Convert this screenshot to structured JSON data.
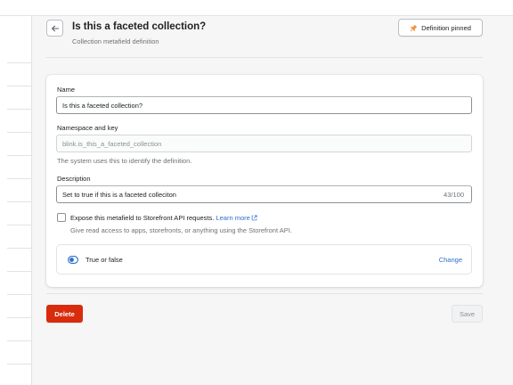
{
  "header": {
    "title": "Is this a faceted collection?",
    "subtitle": "Collection metafield definition",
    "pin_button_label": "Definition pinned",
    "pin_icon_color": "#f49342"
  },
  "form": {
    "name": {
      "label": "Name",
      "value": "Is this a faceted collection?"
    },
    "namespace": {
      "label": "Namespace and key",
      "value": "blink.is_this_a_faceted_collection",
      "help": "The system uses this to identify the definition."
    },
    "description": {
      "label": "Description",
      "value": "Set to true if this is a faceted colleciton",
      "char_count": "43/100"
    },
    "storefront": {
      "checked": false,
      "label": "Expose this metafield to Storefront API requests.",
      "learn_more": "Learn more",
      "help": "Give read access to apps, storefronts, or anything using the Storefront API."
    },
    "type": {
      "icon": "toggle-icon",
      "label": "True or false",
      "change_label": "Change"
    }
  },
  "footer": {
    "delete_label": "Delete",
    "save_label": "Save"
  },
  "colors": {
    "accent_link": "#2c6ecb",
    "destructive": "#d82c0d",
    "toggle_icon": "#2c6ecb"
  }
}
